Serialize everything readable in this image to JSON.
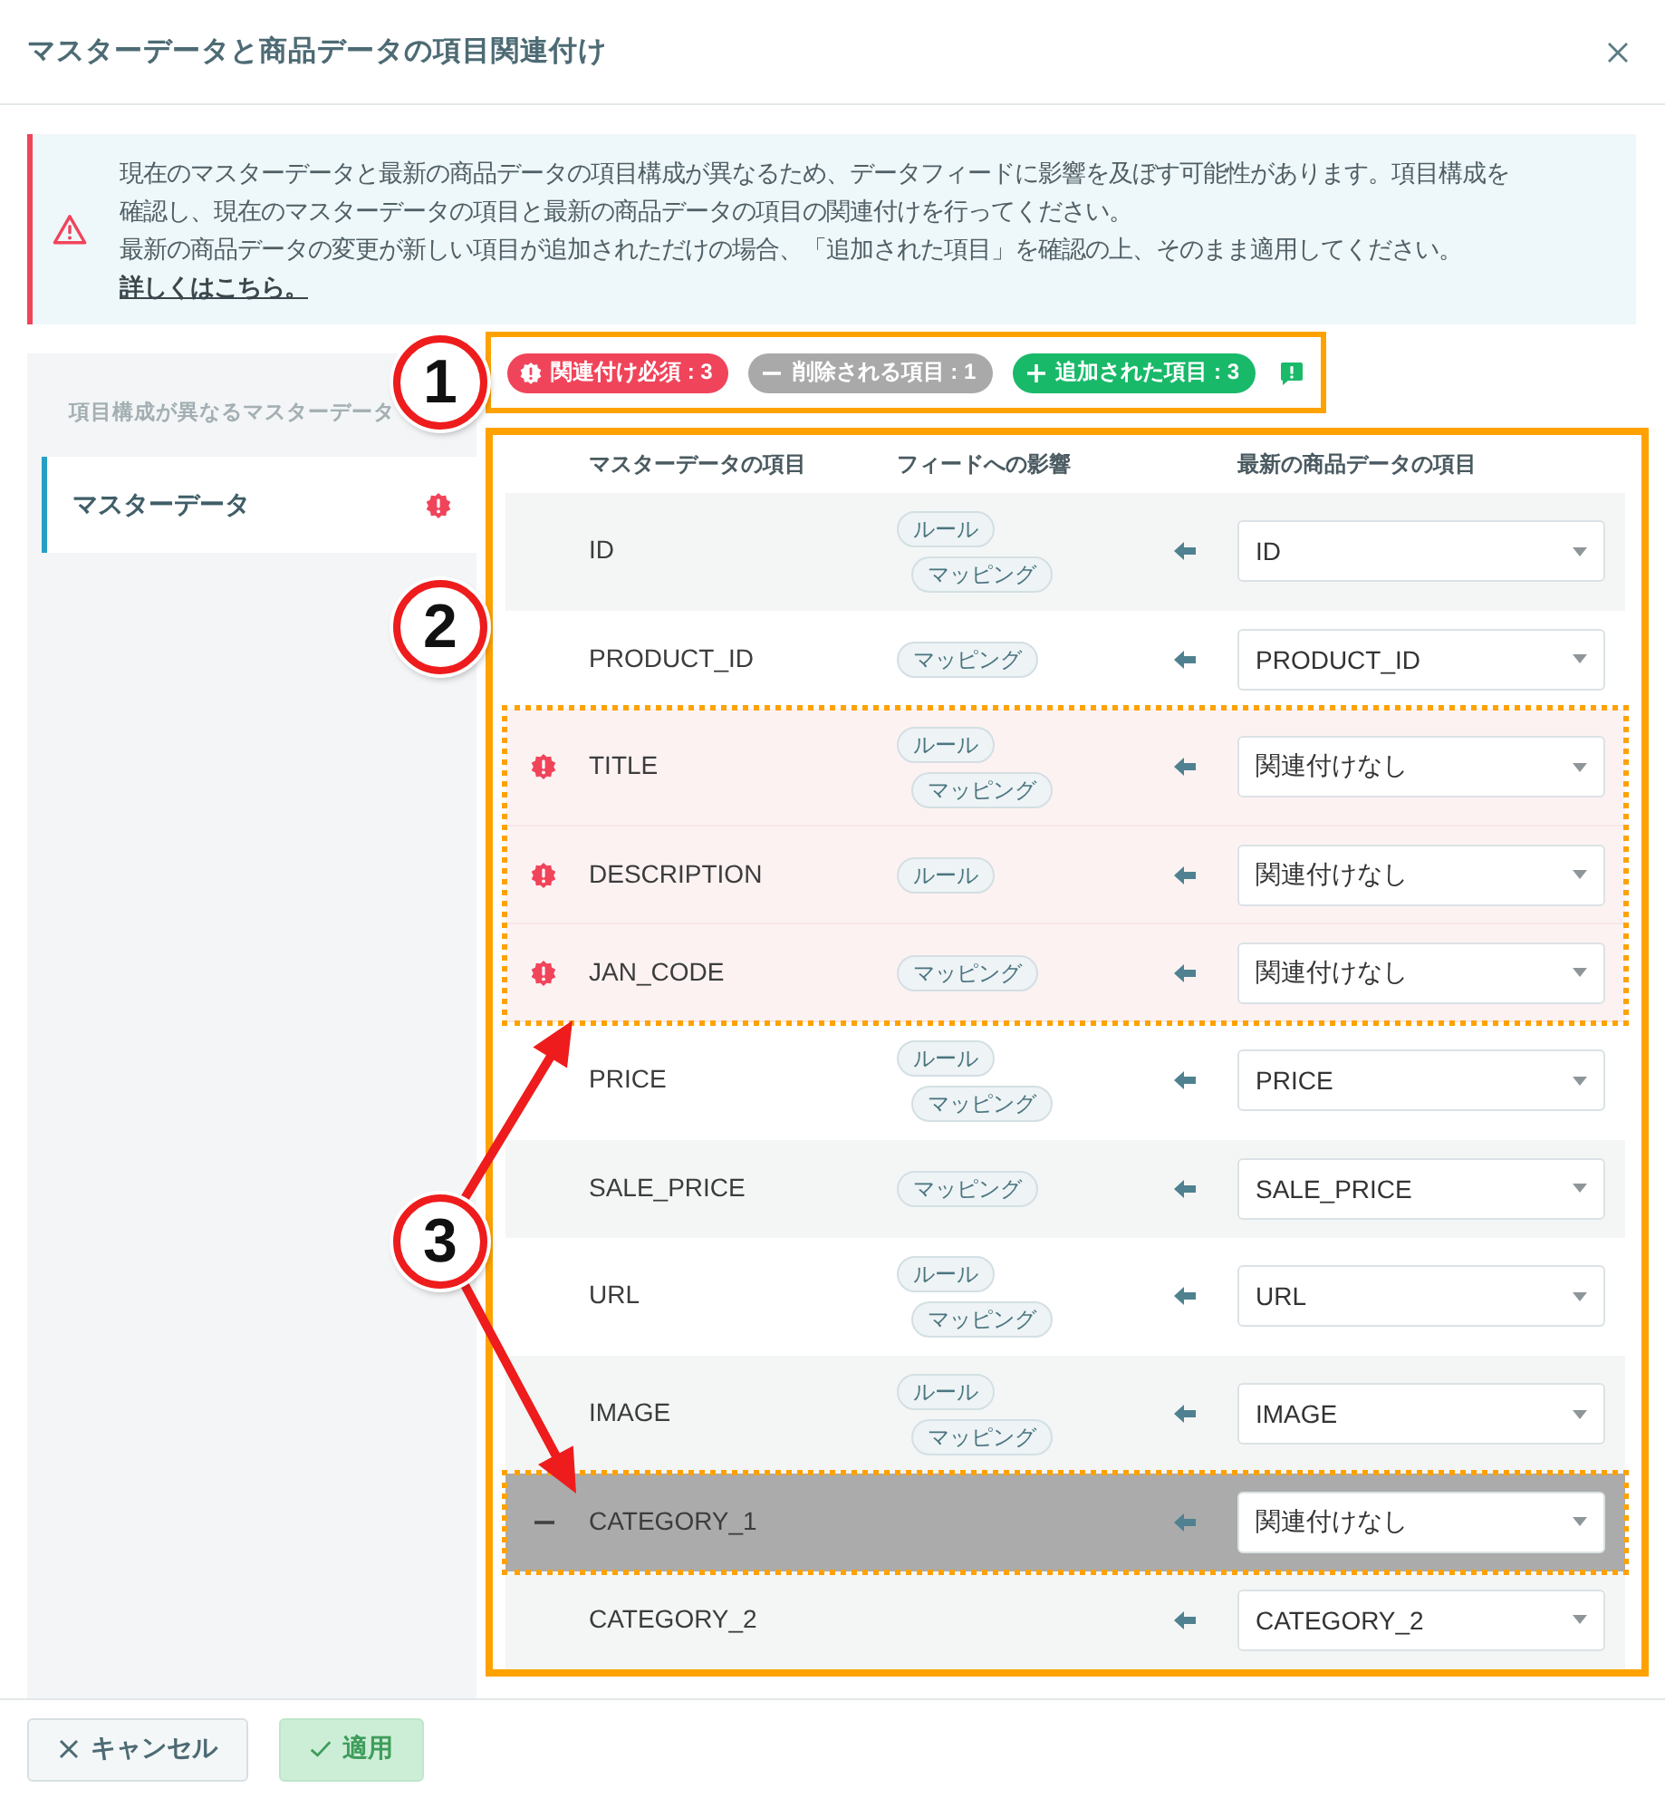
{
  "dialog": {
    "title": "マスターデータと商品データの項目関連付け"
  },
  "alert": {
    "paragraphs": [
      "現在のマスターデータと最新の商品データの項目構成が異なるため、データフィードに影響を及ぼす可能性があります。項目構成を確認し、現在のマスターデータの項目と最新の商品データの項目の関連付けを行ってください。",
      "最新の商品データの変更が新しい項目が追加されただけの場合、「追加された項目」を確認の上、そのまま適用してください。"
    ],
    "link": "詳しくはこちら。"
  },
  "sidebar": {
    "heading": "項目構成が異なるマスターデータ",
    "items": [
      {
        "label": "マスターデータ",
        "selected": true,
        "error": true
      }
    ]
  },
  "summary_badges": [
    {
      "kind": "required",
      "label": "関連付け必須 : 3"
    },
    {
      "kind": "deleted",
      "label": "削除される項目 : 1"
    },
    {
      "kind": "added",
      "label": "追加された項目 : 3"
    }
  ],
  "table": {
    "columns": [
      "マスターデータの項目",
      "フィードへの影響",
      "最新の商品データの項目"
    ],
    "rows": [
      {
        "kind": "normal",
        "name": "ID",
        "impacts": [
          "ルール",
          "マッピング"
        ],
        "mapped": "ID"
      },
      {
        "kind": "normal",
        "name": "PRODUCT_ID",
        "impacts": [
          "マッピング"
        ],
        "mapped": "PRODUCT_ID"
      },
      {
        "kind": "required",
        "name": "TITLE",
        "impacts": [
          "ルール",
          "マッピング"
        ],
        "mapped": "関連付けなし"
      },
      {
        "kind": "required",
        "name": "DESCRIPTION",
        "impacts": [
          "ルール"
        ],
        "mapped": "関連付けなし"
      },
      {
        "kind": "required",
        "name": "JAN_CODE",
        "impacts": [
          "マッピング"
        ],
        "mapped": "関連付けなし"
      },
      {
        "kind": "normal",
        "name": "PRICE",
        "impacts": [
          "ルール",
          "マッピング"
        ],
        "mapped": "PRICE"
      },
      {
        "kind": "normal",
        "name": "SALE_PRICE",
        "impacts": [
          "マッピング"
        ],
        "mapped": "SALE_PRICE"
      },
      {
        "kind": "normal",
        "name": "URL",
        "impacts": [
          "ルール",
          "マッピング"
        ],
        "mapped": "URL"
      },
      {
        "kind": "normal",
        "name": "IMAGE",
        "impacts": [
          "ルール",
          "マッピング"
        ],
        "mapped": "IMAGE"
      },
      {
        "kind": "deleted",
        "name": "CATEGORY_1",
        "mapped": "関連付けなし"
      },
      {
        "kind": "normal",
        "name": "CATEGORY_2",
        "mapped": "CATEGORY_2"
      }
    ]
  },
  "footer": {
    "buttons": [
      {
        "kind": "cancel",
        "label": "キャンセル",
        "disabled": false
      },
      {
        "kind": "apply",
        "label": "適用",
        "disabled": true
      }
    ]
  },
  "callouts": [
    {
      "number": "1"
    },
    {
      "number": "2"
    },
    {
      "number": "3"
    }
  ]
}
